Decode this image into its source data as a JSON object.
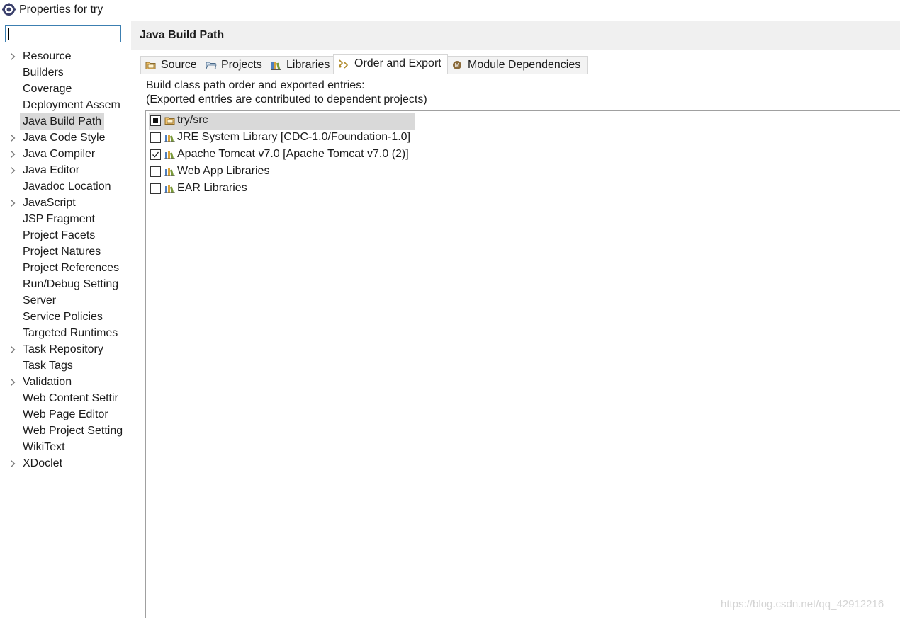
{
  "window": {
    "title": "Properties for try"
  },
  "filter": {
    "value": ""
  },
  "tree": {
    "items": [
      {
        "label": "Resource",
        "expandable": true
      },
      {
        "label": "Builders",
        "expandable": false
      },
      {
        "label": "Coverage",
        "expandable": false
      },
      {
        "label": "Deployment Assem",
        "expandable": false
      },
      {
        "label": "Java Build Path",
        "expandable": false,
        "selected": true
      },
      {
        "label": "Java Code Style",
        "expandable": true
      },
      {
        "label": "Java Compiler",
        "expandable": true
      },
      {
        "label": "Java Editor",
        "expandable": true
      },
      {
        "label": "Javadoc Location",
        "expandable": false
      },
      {
        "label": "JavaScript",
        "expandable": true
      },
      {
        "label": "JSP Fragment",
        "expandable": false
      },
      {
        "label": "Project Facets",
        "expandable": false
      },
      {
        "label": "Project Natures",
        "expandable": false
      },
      {
        "label": "Project References",
        "expandable": false
      },
      {
        "label": "Run/Debug Setting",
        "expandable": false
      },
      {
        "label": "Server",
        "expandable": false
      },
      {
        "label": "Service Policies",
        "expandable": false
      },
      {
        "label": "Targeted Runtimes",
        "expandable": false
      },
      {
        "label": "Task Repository",
        "expandable": true
      },
      {
        "label": "Task Tags",
        "expandable": false
      },
      {
        "label": "Validation",
        "expandable": true
      },
      {
        "label": "Web Content Settir",
        "expandable": false
      },
      {
        "label": "Web Page Editor",
        "expandable": false
      },
      {
        "label": "Web Project Setting",
        "expandable": false
      },
      {
        "label": "WikiText",
        "expandable": false
      },
      {
        "label": "XDoclet",
        "expandable": true
      }
    ]
  },
  "page": {
    "title": "Java Build Path",
    "tabs": [
      {
        "label": "Source",
        "icon": "source-folder-icon"
      },
      {
        "label": "Projects",
        "icon": "projects-folder-icon"
      },
      {
        "label": "Libraries",
        "icon": "libraries-icon"
      },
      {
        "label": "Order and Export",
        "icon": "order-export-icon",
        "active": true
      },
      {
        "label": "Module Dependencies",
        "icon": "module-icon"
      }
    ],
    "description_line1": "Build class path order and exported entries:",
    "description_line2": "(Exported entries are contributed to dependent projects)",
    "entries": [
      {
        "label": "try/src",
        "state": "partial",
        "icon": "source-folder-icon",
        "selected": true
      },
      {
        "label": "JRE System Library [CDC-1.0/Foundation-1.0]",
        "state": "unchecked",
        "icon": "library-icon"
      },
      {
        "label": "Apache Tomcat v7.0 [Apache Tomcat v7.0 (2)]",
        "state": "checked",
        "icon": "library-icon"
      },
      {
        "label": "Web App Libraries",
        "state": "unchecked",
        "icon": "library-icon"
      },
      {
        "label": "EAR Libraries",
        "state": "unchecked",
        "icon": "library-icon"
      }
    ]
  },
  "watermark": "https://blog.csdn.net/qq_42912216",
  "colors": {
    "selection": "#d9d9d9",
    "focus_border": "#3c7fb1",
    "header_bg": "#f0f0f0"
  }
}
